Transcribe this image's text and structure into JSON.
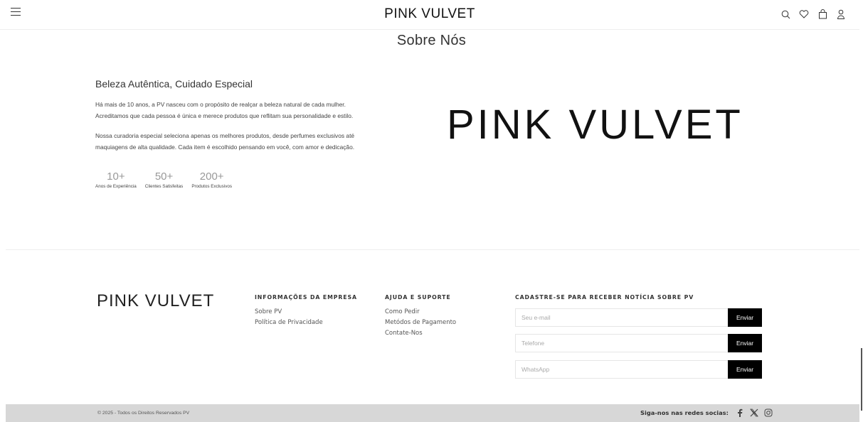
{
  "header": {
    "brand": "PINK VULVET",
    "icons": [
      "menu-icon",
      "search-icon",
      "heart-icon",
      "bag-icon",
      "user-icon"
    ]
  },
  "about": {
    "title": "Sobre Nós",
    "heading": "Beleza Autêntica, Cuidado Especial",
    "paragraph1_line1": "Há mais de 10 anos, a PV nasceu com o propósito de realçar a beleza natural de cada mulher.",
    "paragraph1_line2": "Acreditamos que cada pessoa é única e merece produtos que reflitam sua personalidade e estilo.",
    "paragraph2_line1": "Nossa curadoria especial seleciona apenas os melhores produtos, desde perfumes exclusivos até",
    "paragraph2_line2": "maquiagens de alta qualidade. Cada item é escolhido pensando em você, com amor e dedicação.",
    "stats": [
      {
        "value": "10+",
        "label": "Anos de Experiência"
      },
      {
        "value": "50+",
        "label": "Clientes Satisfeitas"
      },
      {
        "value": "200+",
        "label": "Produtos Exclusivos"
      }
    ],
    "logo": "PINK VULVET"
  },
  "footer": {
    "logo": "PINK VULVET",
    "company": {
      "heading": "INFORMAÇÕES DA EMPRESA",
      "links": [
        "Sobre PV",
        "Política de Privacidade"
      ]
    },
    "help": {
      "heading": "AJUDA E SUPORTE",
      "links": [
        "Como Pedir",
        "Metódos de Pagamento",
        "Contate-Nos"
      ]
    },
    "subscribe": {
      "heading": "CADASTRE-SE PARA RECEBER NOTÍCIA SOBRE PV",
      "fields": [
        {
          "placeholder": "Seu e-mail",
          "button": "Enviar"
        },
        {
          "placeholder": "Telefone",
          "button": "Enviar"
        },
        {
          "placeholder": "WhatsApp",
          "button": "Enviar"
        }
      ]
    }
  },
  "bottom": {
    "copyright": "© 2025 - Todos os Direitos Reservados PV",
    "social_label": "Siga-nos nas redes socias:",
    "social_icons": [
      "facebook-icon",
      "x-icon",
      "instagram-icon"
    ]
  },
  "colors": {
    "background": "#ffffff",
    "bottom_bar": "#d7d7d7",
    "button": "#000000",
    "stat_number": "#999999"
  }
}
